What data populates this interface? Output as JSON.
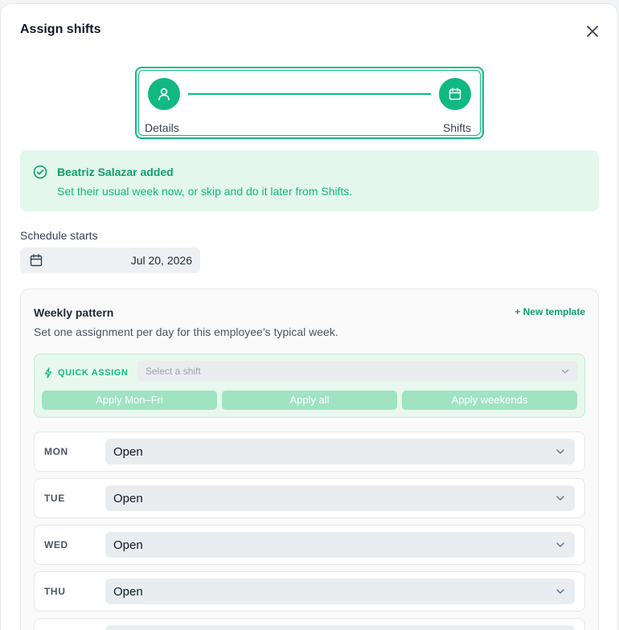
{
  "modal": {
    "title": "Assign shifts"
  },
  "stepper": {
    "steps": [
      {
        "label": "Details"
      },
      {
        "label": "Shifts"
      }
    ]
  },
  "alert": {
    "title": "Beatriz Salazar added",
    "message": "Set their usual week now, or skip and do it later from Shifts."
  },
  "schedule": {
    "label": "Schedule starts",
    "date": "Jul 20, 2026"
  },
  "pattern": {
    "title": "Weekly pattern",
    "subtitle": "Set one assignment per day for this employee’s typical week.",
    "new_template": "+ New template",
    "quick_assign": {
      "label": "QUICK ASSIGN",
      "placeholder": "Select a shift",
      "buttons": [
        "Apply Mon–Fri",
        "Apply all",
        "Apply weekends"
      ]
    },
    "days": [
      {
        "name": "MON",
        "value": "Open"
      },
      {
        "name": "TUE",
        "value": "Open"
      },
      {
        "name": "WED",
        "value": "Open"
      },
      {
        "name": "THU",
        "value": "Open"
      },
      {
        "name": "",
        "value": ""
      }
    ]
  },
  "colors": {
    "accent": "#10b981",
    "accent_dark": "#0e9f6e",
    "alert_bg": "#e3f7ec",
    "button_disabled": "#9fe3c3"
  },
  "icons": {
    "close": "close-icon",
    "details": "user-icon",
    "shifts": "calendar-icon",
    "alert": "check-circle-icon",
    "date": "calendar-icon",
    "quick": "bolt-icon",
    "dropdown": "chevron-down-icon"
  }
}
